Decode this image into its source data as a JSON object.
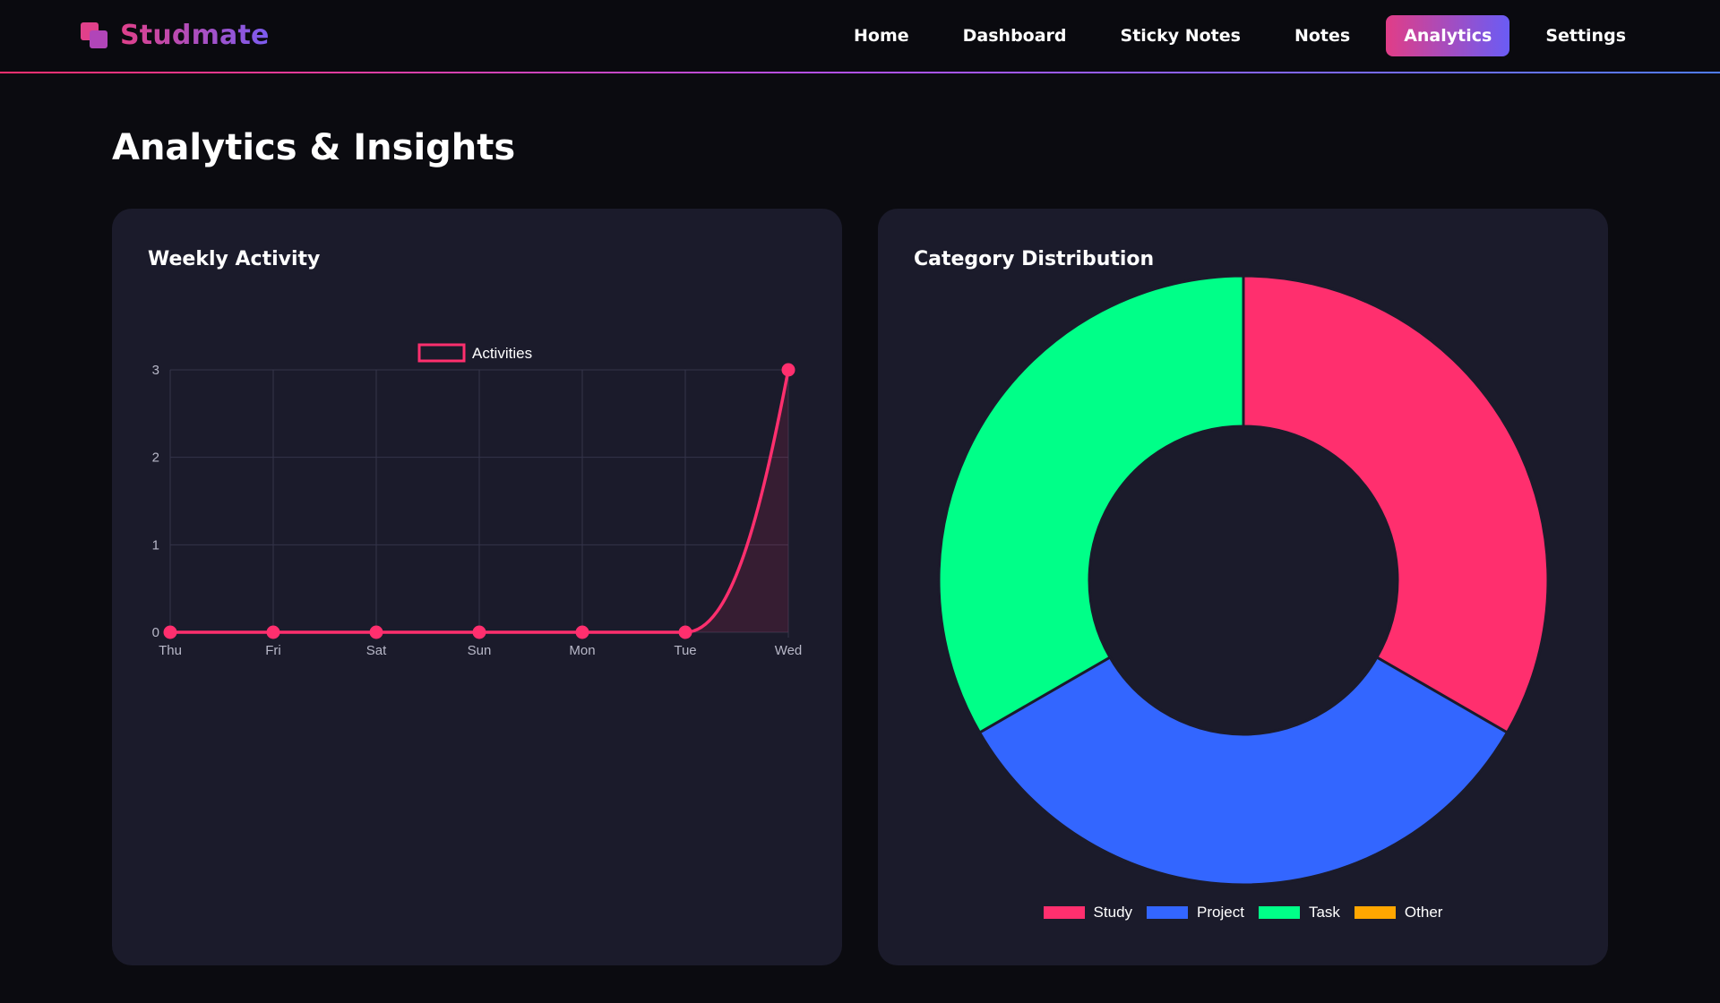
{
  "brand": {
    "name": "Studmate"
  },
  "nav": {
    "items": [
      {
        "label": "Home",
        "active": false
      },
      {
        "label": "Dashboard",
        "active": false
      },
      {
        "label": "Sticky Notes",
        "active": false
      },
      {
        "label": "Notes",
        "active": false
      },
      {
        "label": "Analytics",
        "active": true
      },
      {
        "label": "Settings",
        "active": false
      }
    ]
  },
  "page": {
    "title": "Analytics & Insights"
  },
  "weekly": {
    "title": "Weekly Activity"
  },
  "category": {
    "title": "Category Distribution"
  },
  "colors": {
    "accent": "#ff2f6e",
    "study": "#ff2f6e",
    "project": "#3366ff",
    "task": "#00ff88",
    "other": "#ffa600"
  },
  "chart_data": [
    {
      "type": "line",
      "title": "Weekly Activity",
      "x": [
        "Thu",
        "Fri",
        "Sat",
        "Sun",
        "Mon",
        "Tue",
        "Wed"
      ],
      "series": [
        {
          "name": "Activities",
          "values": [
            0,
            0,
            0,
            0,
            0,
            0,
            3
          ],
          "color": "#ff2f6e"
        }
      ],
      "yticks": [
        0,
        1,
        2,
        3
      ],
      "ylim": [
        0,
        3
      ],
      "grid": true,
      "legend": "top-center",
      "fill": true
    },
    {
      "type": "pie",
      "title": "Category Distribution",
      "donut": true,
      "labels": [
        "Study",
        "Project",
        "Task",
        "Other"
      ],
      "values": [
        1,
        1,
        1,
        0
      ],
      "colors": [
        "#ff2f6e",
        "#3366ff",
        "#00ff88",
        "#ffa600"
      ],
      "legend": "bottom"
    }
  ]
}
